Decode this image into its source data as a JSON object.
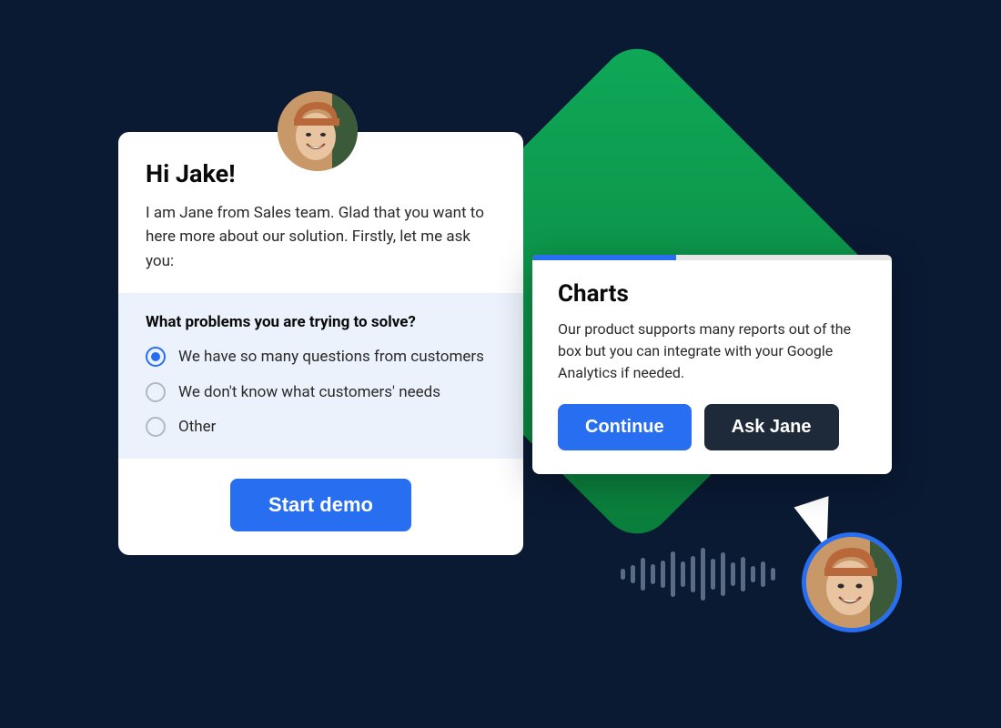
{
  "leftCard": {
    "greeting": "Hi Jake!",
    "intro": "I am Jane from Sales team. Glad that you want to here more about our solution. Firstly, let me ask you:",
    "questionTitle": "What problems you are trying to solve?",
    "options": [
      {
        "label": "We have so many questions from customers",
        "selected": true
      },
      {
        "label": "We don't know what customers' needs",
        "selected": false
      },
      {
        "label": "Other",
        "selected": false
      }
    ],
    "startButton": "Start demo"
  },
  "rightCard": {
    "title": "Charts",
    "body": "Our product supports many reports out of the box but you can integrate with your Google Analytics if needed.",
    "continueButton": "Continue",
    "askButton": "Ask Jane",
    "progressPercent": 40
  },
  "waveform": [
    12,
    20,
    36,
    22,
    30,
    50,
    28,
    40,
    58,
    34,
    48,
    26,
    38,
    18,
    28,
    14
  ]
}
